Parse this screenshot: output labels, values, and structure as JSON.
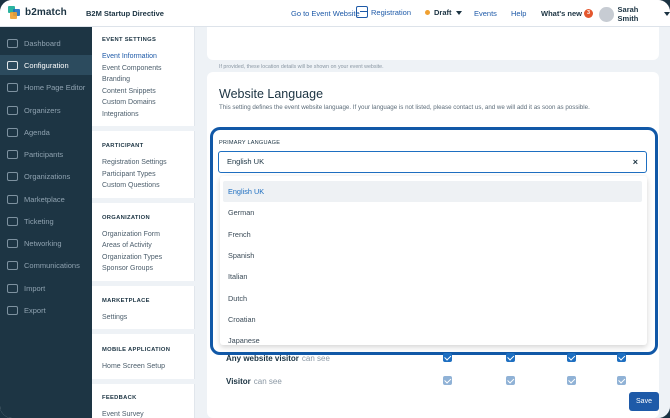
{
  "app": {
    "logo_text": "b2match",
    "event_name": "B2M Startup Directive"
  },
  "topbar": {
    "goto_event": "Go to Event Website",
    "registration": "Registration",
    "status": "Draft",
    "events": "Events",
    "help": "Help",
    "whats_new": "What's new",
    "whats_new_count": "3",
    "user_name": "Sarah Smith",
    "colors": {
      "link": "#1e5aa8",
      "draft_dot": "#f0a030",
      "badge": "#e4572e"
    }
  },
  "leftnav": {
    "items": [
      {
        "label": "Dashboard",
        "icon": "dashboard-icon"
      },
      {
        "label": "Configuration",
        "icon": "gear-icon",
        "active": true
      },
      {
        "label": "Home Page Editor",
        "icon": "home-icon"
      },
      {
        "label": "Organizers",
        "icon": "organizers-icon"
      },
      {
        "label": "Agenda",
        "icon": "calendar-icon"
      },
      {
        "label": "Participants",
        "icon": "people-icon"
      },
      {
        "label": "Organizations",
        "icon": "building-icon"
      },
      {
        "label": "Marketplace",
        "icon": "store-icon"
      },
      {
        "label": "Ticketing",
        "icon": "ticket-icon"
      },
      {
        "label": "Networking",
        "icon": "handshake-icon"
      },
      {
        "label": "Communications",
        "icon": "chat-icon"
      },
      {
        "label": "Import",
        "icon": "import-icon"
      },
      {
        "label": "Export",
        "icon": "export-icon"
      }
    ]
  },
  "settings_nav": {
    "event_settings": {
      "heading": "EVENT SETTINGS",
      "items": [
        "Event Information",
        "Event Components",
        "Branding",
        "Content Snippets",
        "Custom Domains",
        "Integrations"
      ]
    },
    "participant": {
      "heading": "PARTICIPANT",
      "items": [
        "Registration Settings",
        "Participant Types",
        "Custom Questions"
      ]
    },
    "organization": {
      "heading": "ORGANIZATION",
      "items": [
        "Organization Form",
        "Areas of Activity",
        "Organization Types",
        "Sponsor Groups"
      ]
    },
    "marketplace": {
      "heading": "MARKETPLACE",
      "items": [
        "Settings"
      ]
    },
    "mobile": {
      "heading": "MOBILE APPLICATION",
      "items": [
        "Home Screen Setup"
      ]
    },
    "feedback": {
      "heading": "FEEDBACK",
      "items": [
        "Event Survey"
      ]
    }
  },
  "main": {
    "location_hint": "If provided, these location details will be shown on your event website.",
    "section_title": "Website Language",
    "section_desc": "This setting defines the event website language. If your language is not listed, please contact us, and we will add it as soon as possible.",
    "primary_label": "PRIMARY LANGUAGE",
    "primary_value": "English UK",
    "clear_glyph": "×",
    "options": [
      "English UK",
      "German",
      "French",
      "Spanish",
      "Italian",
      "Dutch",
      "Croatian",
      "Japanese"
    ],
    "visibility_rows": [
      {
        "who": "Any website visitor",
        "can": "can see"
      },
      {
        "who": "Visitor",
        "can": "can see"
      }
    ],
    "save_label": "Save",
    "colors": {
      "highlight": "#1158a7",
      "checkbox": "#1e6fc1"
    }
  }
}
